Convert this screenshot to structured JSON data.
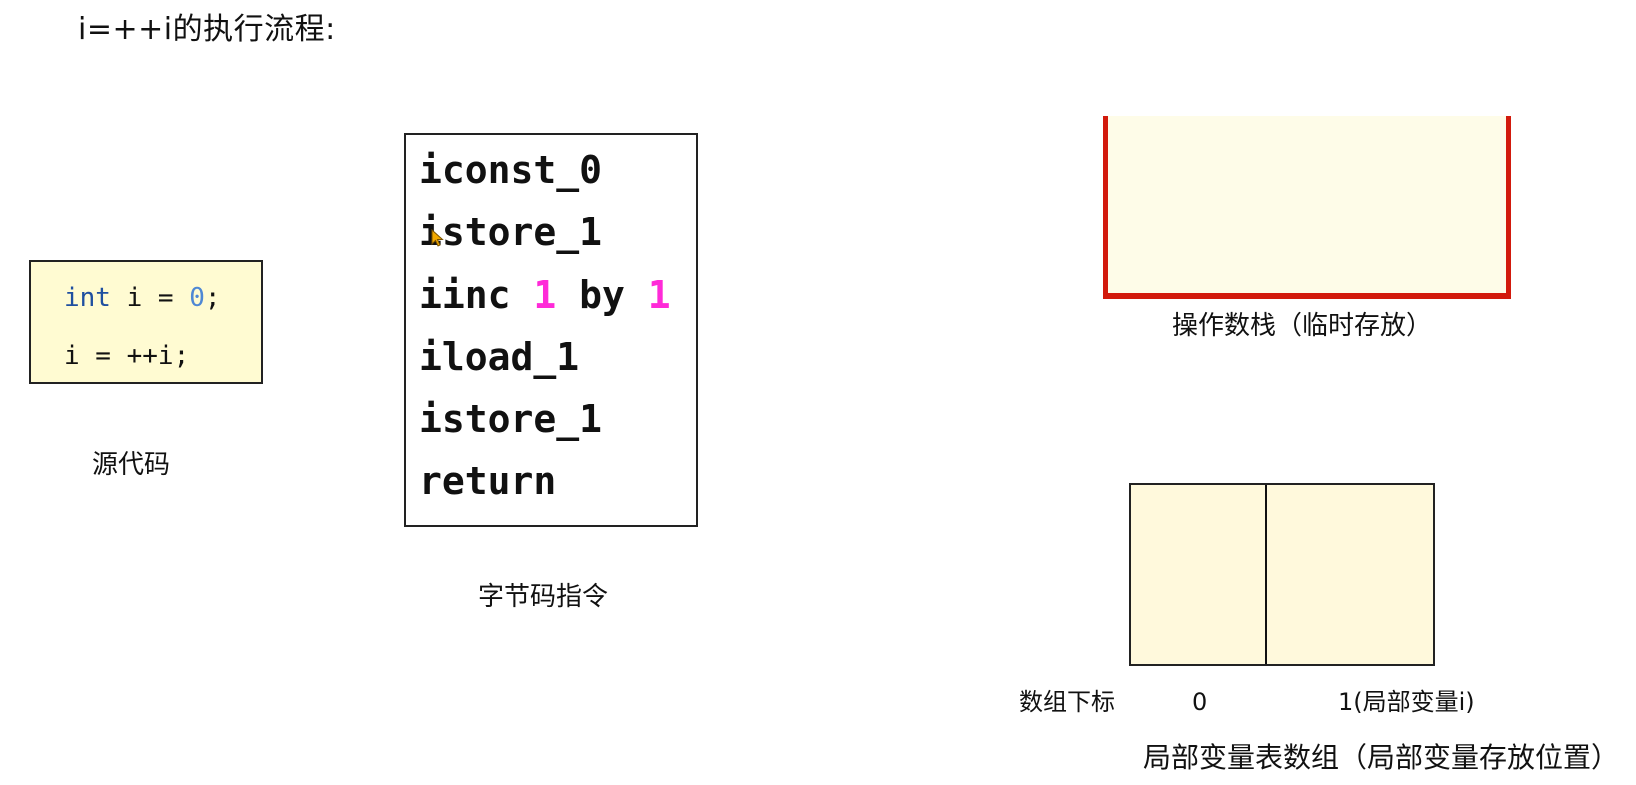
{
  "title": "i=++i的执行流程:",
  "source_code": {
    "lines": [
      {
        "keyword": "int",
        "rest_before": " i = ",
        "number": "0",
        "rest_after": ";"
      },
      {
        "text": "i = ++i;"
      }
    ],
    "label": "源代码"
  },
  "bytecode": {
    "instructions": [
      {
        "op": "iconst_0"
      },
      {
        "op": "istore_1"
      },
      {
        "op": "iinc ",
        "arg1": "1",
        "mid": " by ",
        "arg2": "1"
      },
      {
        "op": "iload_1"
      },
      {
        "op": "istore_1"
      },
      {
        "op": "return"
      }
    ],
    "label": "字节码指令"
  },
  "operand_stack": {
    "label": "操作数栈（临时存放）",
    "items": []
  },
  "local_variable_table": {
    "index_title": "数组下标",
    "slots": [
      {
        "index": "0",
        "value": ""
      },
      {
        "index": "1(局部变量i)",
        "value": ""
      }
    ],
    "label": "局部变量表数组（局部变量存放位置）"
  },
  "colors": {
    "stack_border": "#d21a0c",
    "box_fill": "#fffbd2",
    "keyword": "#1f4fa0",
    "number_literal": "#4f88d4",
    "bytecode_arg": "#ff2ad8"
  }
}
